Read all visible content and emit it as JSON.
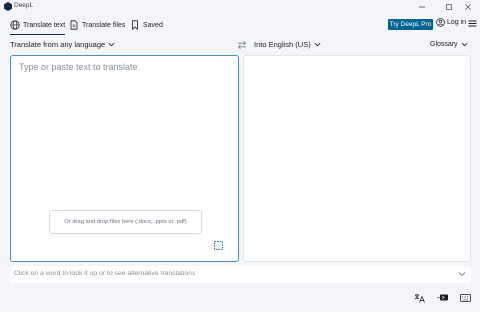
{
  "window": {
    "title": "DeepL"
  },
  "nav": {
    "tabs": [
      {
        "label": "Translate text",
        "icon": "globe-icon"
      },
      {
        "label": "Translate files",
        "icon": "file-icon"
      },
      {
        "label": "Saved",
        "icon": "bookmark-icon"
      }
    ],
    "pro_button": "Try DeepL Pro",
    "login": "Log in"
  },
  "languages": {
    "source": "Translate from any language",
    "target": "Into English (US)",
    "glossary": "Glossary"
  },
  "source_panel": {
    "placeholder": "Type or paste text to translate",
    "drop_hint": "Or drag and drop files here (.docx, .pptx or .pdf)"
  },
  "dictionary": {
    "hint": "Click on a word to look it up or to see alternative translations"
  },
  "colors": {
    "accent": "#006494",
    "focus_border": "#5a8bb3",
    "background": "#f3f5f8"
  }
}
